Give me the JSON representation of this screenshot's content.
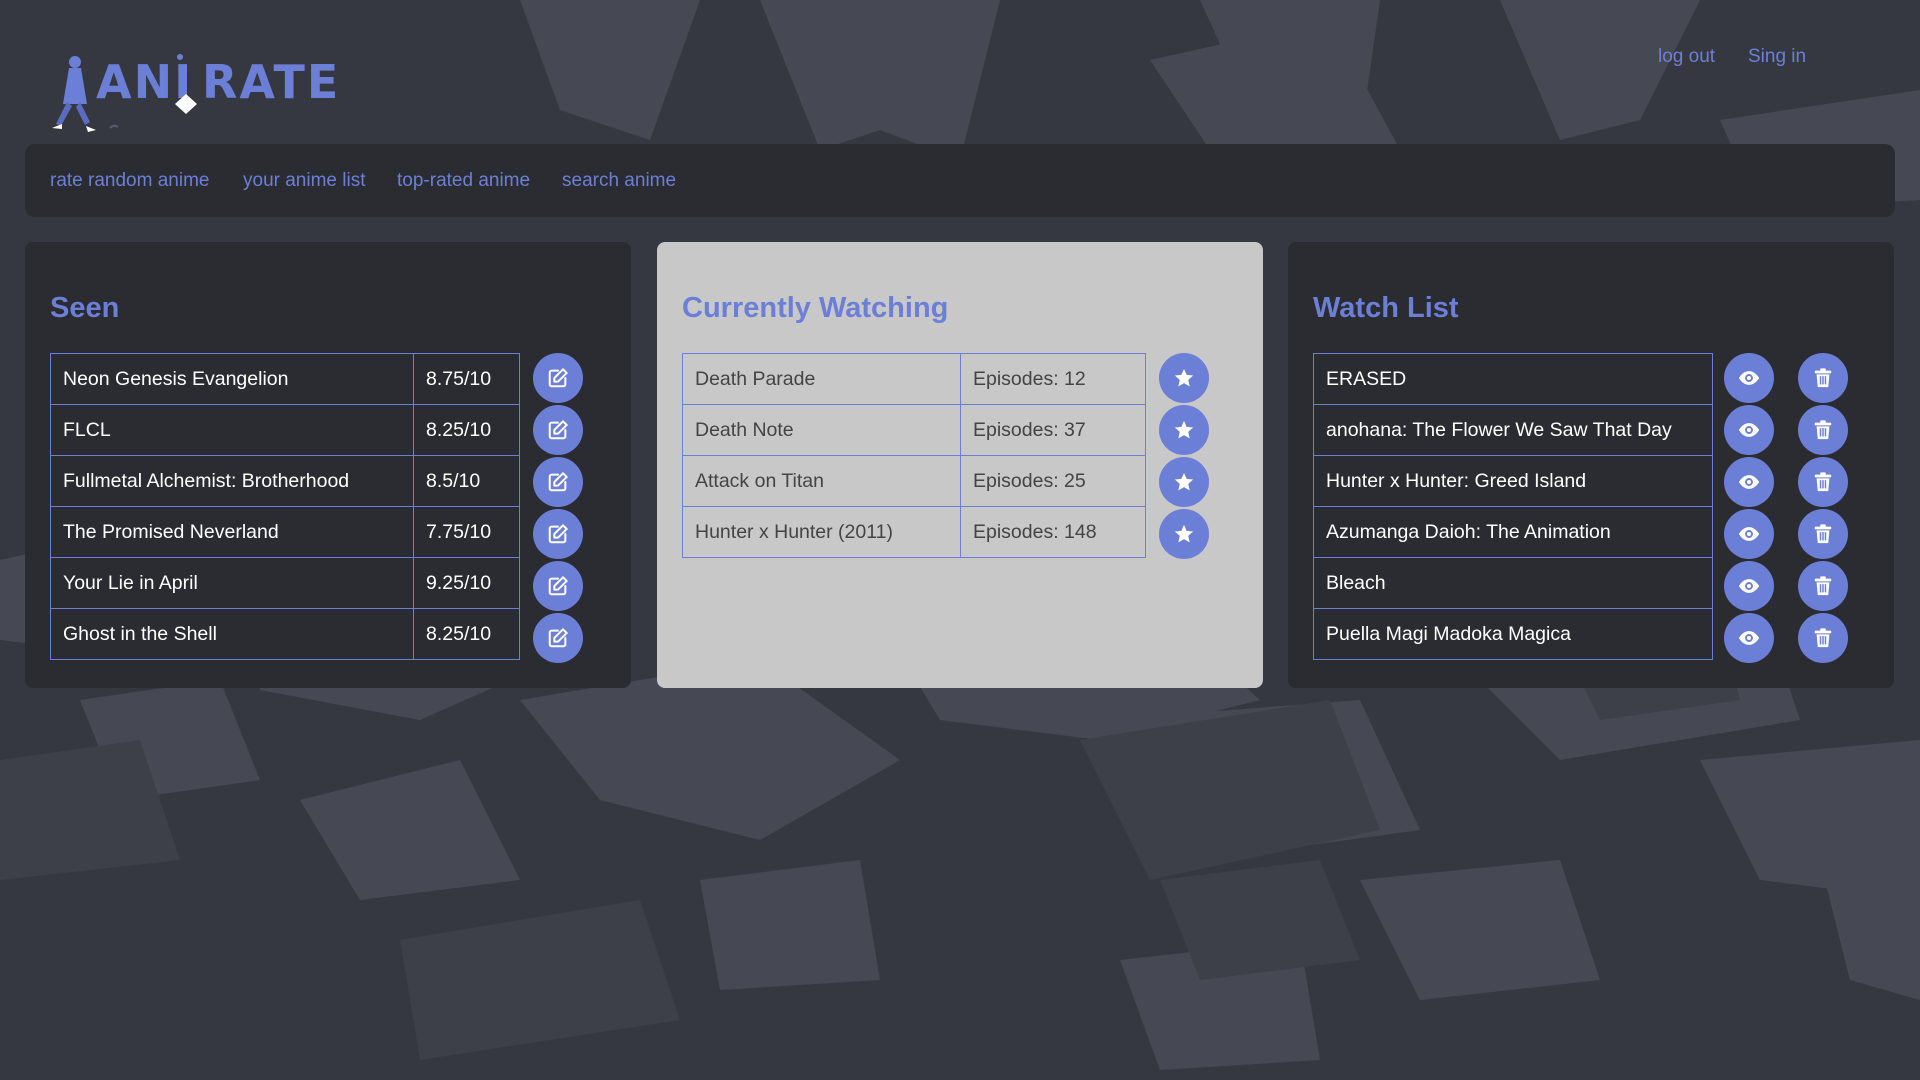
{
  "brand": {
    "logo_text": "ANI RATE"
  },
  "auth": {
    "logout_label": "log out",
    "signin_label": "Sing in"
  },
  "nav": {
    "items": [
      {
        "label": "rate random anime"
      },
      {
        "label": "your anime list"
      },
      {
        "label": "top-rated anime"
      },
      {
        "label": "search anime"
      }
    ]
  },
  "seen": {
    "title": "Seen",
    "rows": [
      {
        "name": "Neon Genesis Evangelion",
        "score": "8.75/10",
        "action_icon": "edit-icon"
      },
      {
        "name": "FLCL",
        "score": "8.25/10",
        "action_icon": "edit-icon"
      },
      {
        "name": "Fullmetal Alchemist: Brotherhood",
        "score": "8.5/10",
        "action_icon": "edit-icon"
      },
      {
        "name": "The Promised Neverland",
        "score": "7.75/10",
        "action_icon": "edit-icon"
      },
      {
        "name": "Your Lie in April",
        "score": "9.25/10",
        "action_icon": "edit-icon"
      },
      {
        "name": "Ghost in the Shell",
        "score": "8.25/10",
        "action_icon": "edit-icon"
      }
    ]
  },
  "watching": {
    "title": "Currently Watching",
    "rows": [
      {
        "name": "Death Parade",
        "episodes": "Episodes: 12",
        "action_icon": "star-icon"
      },
      {
        "name": "Death Note",
        "episodes": "Episodes: 37",
        "action_icon": "star-icon"
      },
      {
        "name": "Attack on Titan",
        "episodes": "Episodes: 25",
        "action_icon": "star-icon"
      },
      {
        "name": "Hunter x Hunter (2011)",
        "episodes": "Episodes: 148",
        "action_icon": "star-icon"
      }
    ]
  },
  "watchlist": {
    "title": "Watch List",
    "rows": [
      {
        "name": "ERASED",
        "action_icons": [
          "eye-icon",
          "trash-icon"
        ]
      },
      {
        "name": "anohana: The Flower We Saw That Day",
        "action_icons": [
          "eye-icon",
          "trash-icon"
        ]
      },
      {
        "name": "Hunter x Hunter: Greed Island",
        "action_icons": [
          "eye-icon",
          "trash-icon"
        ]
      },
      {
        "name": "Azumanga Daioh: The Animation",
        "action_icons": [
          "eye-icon",
          "trash-icon"
        ]
      },
      {
        "name": "Bleach",
        "action_icons": [
          "eye-icon",
          "trash-icon"
        ]
      },
      {
        "name": "Puella Magi Madoka Magica",
        "action_icons": [
          "eye-icon",
          "trash-icon"
        ]
      }
    ]
  },
  "colors": {
    "page_background": "#363841",
    "panel_dark": "#2b2c31",
    "panel_light": "#c8c8c8",
    "accent": "#6c7fd6"
  }
}
